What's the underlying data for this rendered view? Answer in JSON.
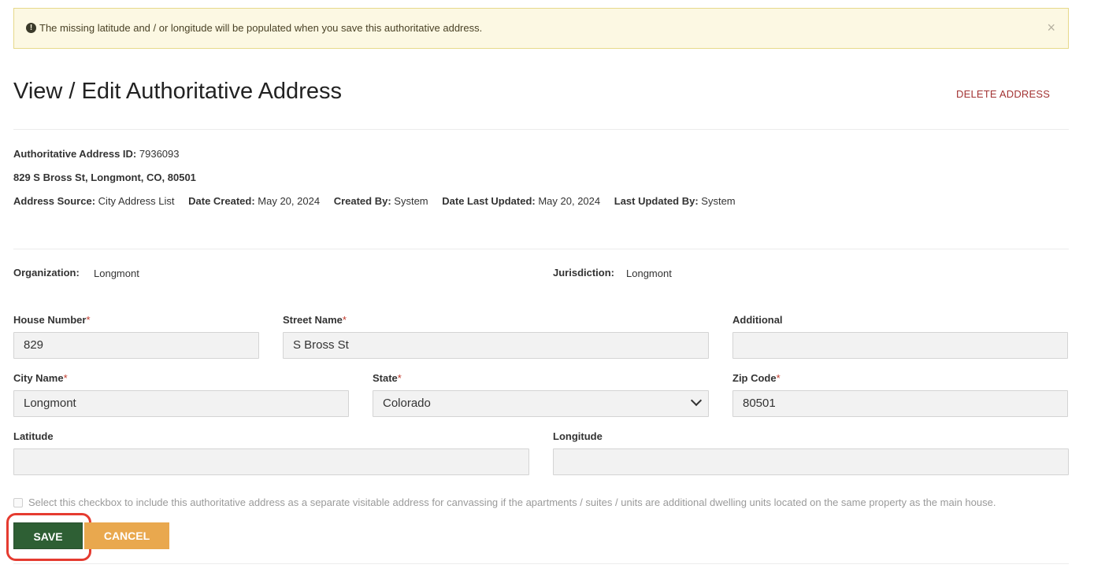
{
  "alert": {
    "icon": "exclamation-circle-icon",
    "message": "The missing latitude and / or longitude will be populated when you save this authoritative address.",
    "close_label": "×"
  },
  "header": {
    "title": "View / Edit Authoritative Address",
    "delete_label": "DELETE ADDRESS"
  },
  "details": {
    "id_label": "Authoritative Address ID:",
    "id_value": "7936093",
    "full_address": "829 S Bross St, Longmont, CO, 80501",
    "source_label": "Address Source:",
    "source_value": "City Address List",
    "created_label": "Date Created:",
    "created_value": "May 20, 2024",
    "created_by_label": "Created By:",
    "created_by_value": "System",
    "updated_label": "Date Last Updated:",
    "updated_value": "May 20, 2024",
    "updated_by_label": "Last Updated By:",
    "updated_by_value": "System"
  },
  "org": {
    "org_label": "Organization:",
    "org_value": "Longmont",
    "jur_label": "Jurisdiction:",
    "jur_value": "Longmont"
  },
  "form": {
    "required_mark": "*",
    "house_number": {
      "label": "House Number",
      "value": "829"
    },
    "street_name": {
      "label": "Street Name",
      "value": "S Bross St"
    },
    "additional": {
      "label": "Additional",
      "value": ""
    },
    "city_name": {
      "label": "City Name",
      "value": "Longmont"
    },
    "state": {
      "label": "State",
      "value": "Colorado"
    },
    "zip_code": {
      "label": "Zip Code",
      "value": "80501"
    },
    "latitude": {
      "label": "Latitude",
      "value": ""
    },
    "longitude": {
      "label": "Longitude",
      "value": ""
    },
    "checkbox_text": "Select this checkbox to include this authoritative address as a separate visitable address for canvassing if the apartments / suites / units are additional dwelling units located on the same property as the main house.",
    "checkbox_checked": false
  },
  "actions": {
    "save_label": "SAVE",
    "cancel_label": "CANCEL"
  },
  "colors": {
    "save": "#2e5f34",
    "cancel": "#e9a84e",
    "delete": "#a33333",
    "highlight": "#e53b30",
    "alert_bg": "#fcf8e3"
  }
}
